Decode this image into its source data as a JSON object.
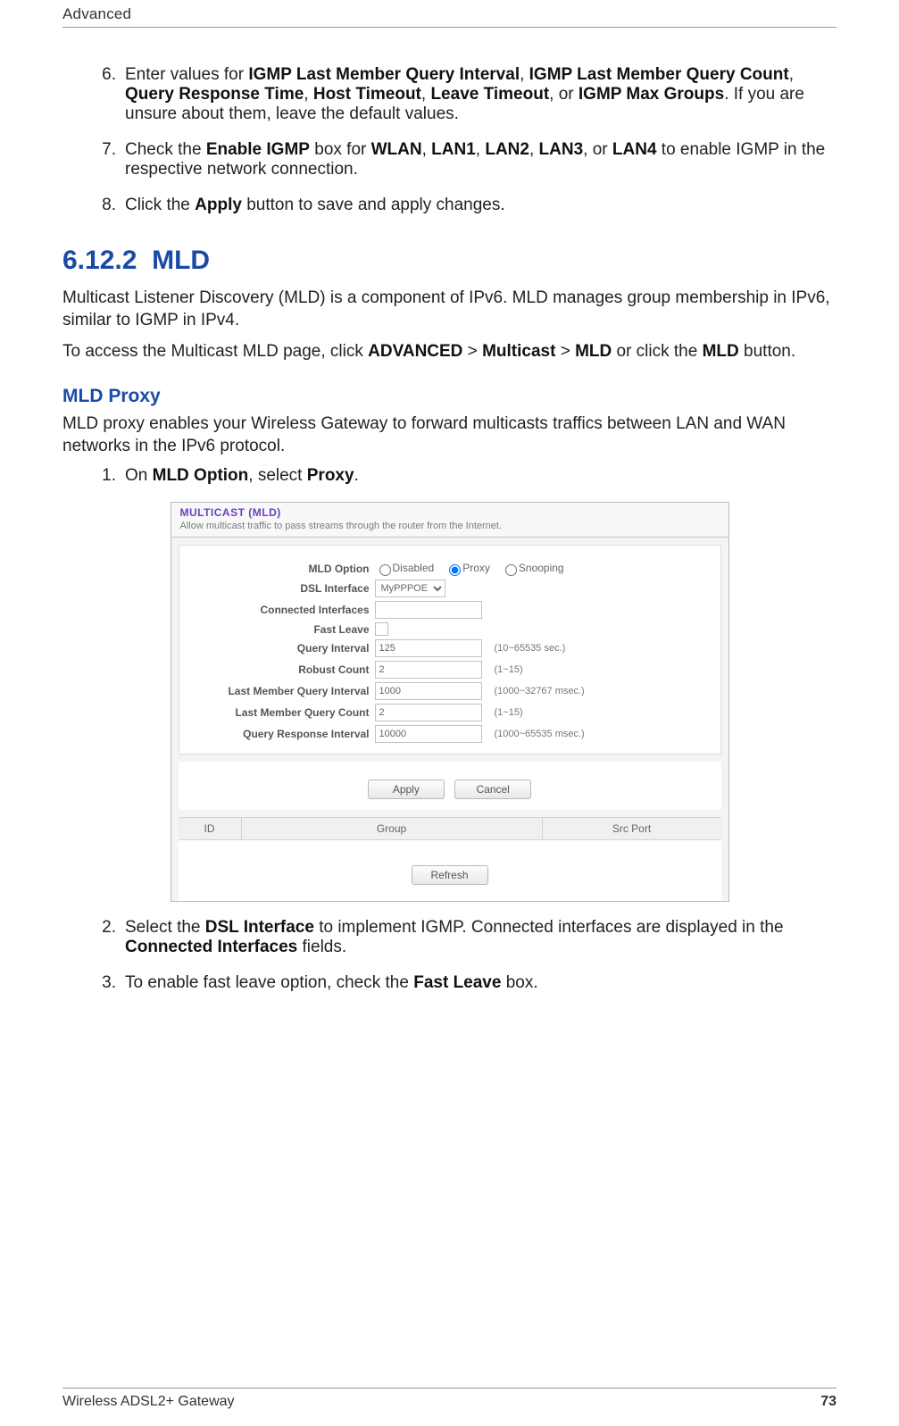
{
  "running_head": "Advanced",
  "steps_a": [
    {
      "num": "6.",
      "pre": "Enter values for ",
      "bold_list": [
        "IGMP Last Member Query Interval",
        ", ",
        "IGMP Last Member Query Count",
        ", ",
        "Query Response Time",
        ", ",
        "Host Timeout",
        ", ",
        "Leave Timeout",
        ", or ",
        "IGMP Max Groups"
      ],
      "post": ". If you are unsure about them, leave the default values."
    },
    {
      "num": "7.",
      "pre": "Check the ",
      "bold_list": [
        "Enable IGMP",
        " box for ",
        "WLAN",
        ", ",
        "LAN1",
        ", ",
        "LAN2",
        ", ",
        "LAN3",
        ", or ",
        "LAN4"
      ],
      "post": " to enable IGMP in the respective network connection."
    },
    {
      "num": "8.",
      "pre": "Click the ",
      "bold_list": [
        "Apply"
      ],
      "post": " button to save and apply changes."
    }
  ],
  "section": {
    "number": "6.12.2",
    "title": "MLD",
    "para1": "Multicast Listener Discovery (MLD) is a component of IPv6. MLD manages group membership in IPv6, similar to IGMP in IPv4.",
    "para2_pre": "To access the Multicast MLD page, click ",
    "para2_path": [
      "ADVANCED",
      " > ",
      "Multicast",
      " > ",
      "MLD"
    ],
    "para2_mid": " or click the ",
    "para2_btn": "MLD",
    "para2_post": " button."
  },
  "subhead": "MLD Proxy",
  "sub_para": "MLD proxy enables your Wireless Gateway to forward multicasts traffics between LAN and WAN networks in the IPv6 protocol.",
  "steps_b": [
    {
      "num": "1.",
      "segments": [
        "On ",
        {
          "b": "MLD Option"
        },
        ", select ",
        {
          "b": "Proxy"
        },
        "."
      ]
    }
  ],
  "panel": {
    "title": "MULTICAST (MLD)",
    "desc": "Allow multicast traffic to pass streams through the router from the Internet.",
    "rows": {
      "mld_option": {
        "label": "MLD Option",
        "opts": [
          "Disabled",
          "Proxy",
          "Snooping"
        ],
        "selected": "Proxy"
      },
      "dsl_iface": {
        "label": "DSL Interface",
        "value": "MyPPPOE"
      },
      "conn_ifaces": {
        "label": "Connected Interfaces",
        "value": ""
      },
      "fast_leave": {
        "label": "Fast Leave",
        "checked": false
      },
      "query_interval": {
        "label": "Query Interval",
        "value": "125",
        "hint": "(10~65535 sec.)"
      },
      "robust_count": {
        "label": "Robust Count",
        "value": "2",
        "hint": "(1~15)"
      },
      "lm_query_interval": {
        "label": "Last Member Query Interval",
        "value": "1000",
        "hint": "(1000~32767 msec.)"
      },
      "lm_query_count": {
        "label": "Last Member Query Count",
        "value": "2",
        "hint": "(1~15)"
      },
      "qr_interval": {
        "label": "Query Response Interval",
        "value": "10000",
        "hint": "(1000~65535 msec.)"
      }
    },
    "buttons": {
      "apply": "Apply",
      "cancel": "Cancel",
      "refresh": "Refresh"
    },
    "table": {
      "id": "ID",
      "group": "Group",
      "src": "Src Port"
    }
  },
  "steps_c": [
    {
      "num": "2.",
      "segments": [
        "Select the ",
        {
          "b": "DSL Interface"
        },
        " to implement IGMP. Connected interfaces are displayed in the ",
        {
          "b": "Connected Interfaces"
        },
        " fields."
      ]
    },
    {
      "num": "3.",
      "segments": [
        "To enable fast leave option, check the ",
        {
          "b": "Fast Leave"
        },
        " box."
      ]
    }
  ],
  "footer": {
    "product": "Wireless ADSL2+ Gateway",
    "page": "73"
  }
}
